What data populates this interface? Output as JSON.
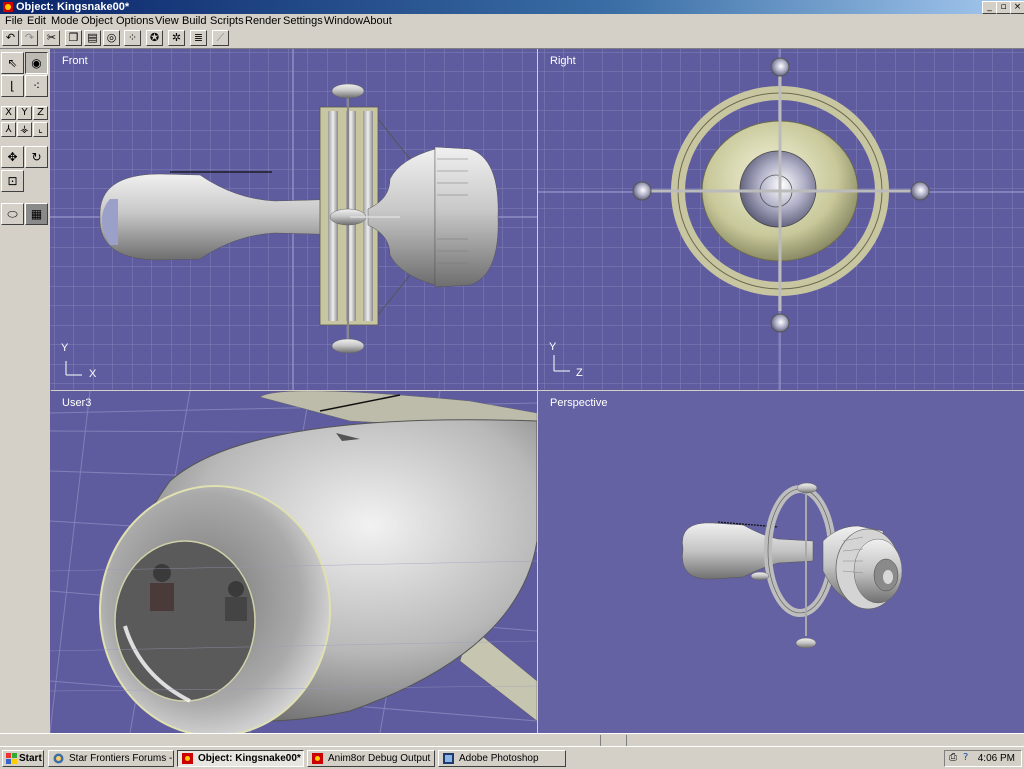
{
  "window": {
    "title": "Object: Kingsnake00*",
    "controls": [
      "_",
      "▫",
      "×"
    ]
  },
  "menu": [
    "File",
    "Edit",
    "Mode",
    "Object",
    "Options",
    "View",
    "Build",
    "Scripts",
    "Render",
    "Settings",
    "Window",
    "About"
  ],
  "toolbar": {
    "icons": [
      "undo-icon",
      "redo-icon",
      "cut-icon",
      "copy-icon",
      "paste-icon",
      "select-all-icon",
      "dots-icon",
      "wheel-icon",
      "gear-icon",
      "list-icon",
      "graph-icon"
    ]
  },
  "palette": {
    "axis_x": "X",
    "axis_y": "Y",
    "axis_z": "Z"
  },
  "viewports": {
    "front": {
      "label": "Front",
      "axis_v": "Y",
      "axis_h": "X"
    },
    "right": {
      "label": "Right",
      "axis_v": "Y",
      "axis_h": "Z"
    },
    "user": {
      "label": "User3"
    },
    "perspective": {
      "label": "Perspective"
    }
  },
  "colors": {
    "viewport_bg": "#5e5c9e",
    "perspective_bg": "#6462a2",
    "grid": "#8280b8",
    "model_gray": "#c8c8c8",
    "model_yellow": "#e0e0b0"
  },
  "taskbar": {
    "start": "Start",
    "tasks": [
      {
        "label": "Star Frontiers Forums - ...",
        "icon": "browser-icon",
        "active": false
      },
      {
        "label": "Object: Kingsnake00*",
        "icon": "anim8or-icon",
        "active": true
      },
      {
        "label": "Anim8or Debug Output",
        "icon": "anim8or-icon",
        "active": false
      },
      {
        "label": "Adobe Photoshop",
        "icon": "photoshop-icon",
        "active": false
      }
    ],
    "clock": "4:06 PM"
  }
}
